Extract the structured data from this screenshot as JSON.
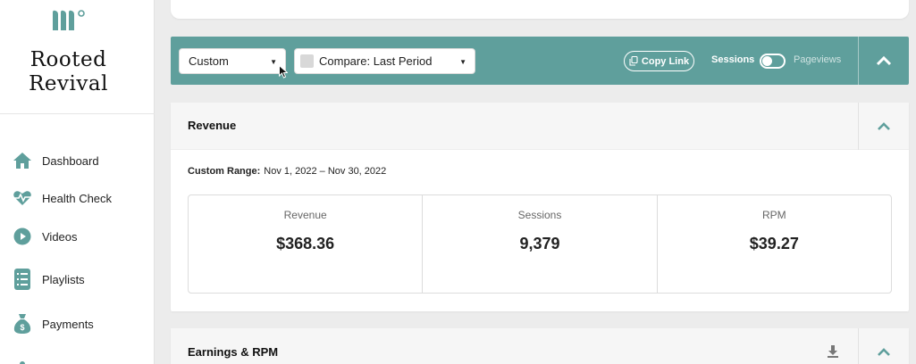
{
  "brand": {
    "name_line1": "Rooted",
    "name_line2": "Revival",
    "logo_icon": "logo-mark-icon",
    "accent_color": "#5f9f9c"
  },
  "sidebar": {
    "items": [
      {
        "label": "Dashboard",
        "icon": "home-icon"
      },
      {
        "label": "Health Check",
        "icon": "heartbeat-icon"
      },
      {
        "label": "Videos",
        "icon": "play-icon"
      },
      {
        "label": "Playlists",
        "icon": "list-icon"
      },
      {
        "label": "Payments",
        "icon": "money-bag-icon"
      }
    ]
  },
  "toolbar": {
    "date_select": {
      "value": "Custom"
    },
    "compare_select": {
      "value": "Compare: Last Period"
    },
    "copy_link_label": "Copy Link",
    "toggle_left_label": "Sessions",
    "toggle_right_label": "Pageviews",
    "background_color": "#5f9f9c"
  },
  "revenue_card": {
    "title": "Revenue",
    "range_label": "Custom Range:",
    "range_value": "Nov 1, 2022 – Nov 30, 2022",
    "metrics": [
      {
        "label": "Revenue",
        "value": "$368.36"
      },
      {
        "label": "Sessions",
        "value": "9,379"
      },
      {
        "label": "RPM",
        "value": "$39.27"
      }
    ]
  },
  "earnings_card": {
    "title": "Earnings & RPM"
  }
}
